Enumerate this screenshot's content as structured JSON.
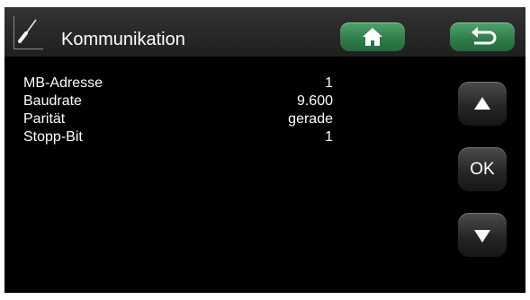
{
  "header": {
    "title": "Kommunikation",
    "title_icon": "screwdriver-icon",
    "home_icon": "home-icon",
    "back_icon": "back-arrow-icon",
    "accent_color": "#3a8f57"
  },
  "settings": [
    {
      "label": "MB-Adresse",
      "value": "1"
    },
    {
      "label": "Baudrate",
      "value": "9.600"
    },
    {
      "label": "Parität",
      "value": "gerade"
    },
    {
      "label": "Stopp-Bit",
      "value": "1"
    }
  ],
  "side_buttons": {
    "up_icon": "arrow-up-icon",
    "ok_label": "OK",
    "down_icon": "arrow-down-icon"
  }
}
